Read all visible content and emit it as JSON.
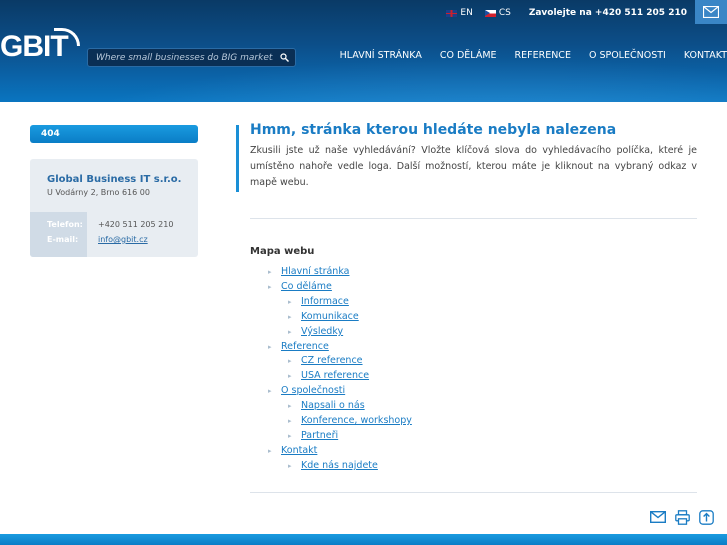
{
  "header": {
    "logo_text": "GBIT",
    "languages": [
      {
        "code": "EN"
      },
      {
        "code": "CS"
      }
    ],
    "phone_text": "Zavolejte na +420 511 205 210",
    "search_placeholder": "Where small businesses do BIG marketing",
    "nav": [
      "HLAVNÍ STRÁNKA",
      "CO DĚLÁME",
      "REFERENCE",
      "O SPOLEČNOSTI",
      "KONTAKT"
    ]
  },
  "sidebar": {
    "box_title": "404",
    "company_name": "Global Business IT s.r.o.",
    "address": "U Vodárny 2, Brno 616 00",
    "phone_label": "Telefon:",
    "phone_value": "+420 511 205 210",
    "email_label": "E-mail:",
    "email_value": "info@gbit.cz"
  },
  "main": {
    "title": "Hmm, stránka kterou hledáte nebyla nalezena",
    "intro": "Zkusili jste už naše vyhledávání? Vložte klíčová slova do vyhledávacího políčka, které je umístěno nahoře vedle loga. Další možností, kterou máte je kliknout na vybraný odkaz v mapě webu.",
    "sitemap_title": "Mapa webu",
    "sitemap": [
      {
        "label": "Hlavní stránka",
        "level": 0
      },
      {
        "label": "Co děláme",
        "level": 0
      },
      {
        "label": "Informace",
        "level": 1
      },
      {
        "label": "Komunikace",
        "level": 1
      },
      {
        "label": "Výsledky",
        "level": 1
      },
      {
        "label": "Reference",
        "level": 0
      },
      {
        "label": "CZ reference",
        "level": 1
      },
      {
        "label": "USA reference",
        "level": 1
      },
      {
        "label": "O společnosti",
        "level": 0
      },
      {
        "label": "Napsali o nás",
        "level": 1
      },
      {
        "label": "Konference, workshopy",
        "level": 1
      },
      {
        "label": "Partneři",
        "level": 1
      },
      {
        "label": "Kontakt",
        "level": 0
      },
      {
        "label": "Kde nás najdete",
        "level": 1
      }
    ]
  },
  "tools": [
    "mail-icon",
    "print-icon",
    "scroll-top-icon"
  ]
}
